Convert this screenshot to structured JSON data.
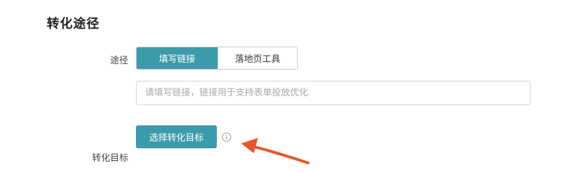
{
  "section": {
    "title": "转化途径"
  },
  "path": {
    "label": "途径",
    "options": [
      "填写链接",
      "落地页工具"
    ],
    "selected": "填写链接"
  },
  "link_input": {
    "placeholder": "请填写链接，链接用于支持表单投放优化",
    "value": ""
  },
  "goal": {
    "label": "转化目标",
    "button_label": "选择转化目标"
  },
  "icons": {
    "info": "info-circle-icon",
    "annotation": "red-arrow-annotation"
  },
  "colors": {
    "accent": "#3c9bab",
    "arrow": "#e8562a"
  }
}
